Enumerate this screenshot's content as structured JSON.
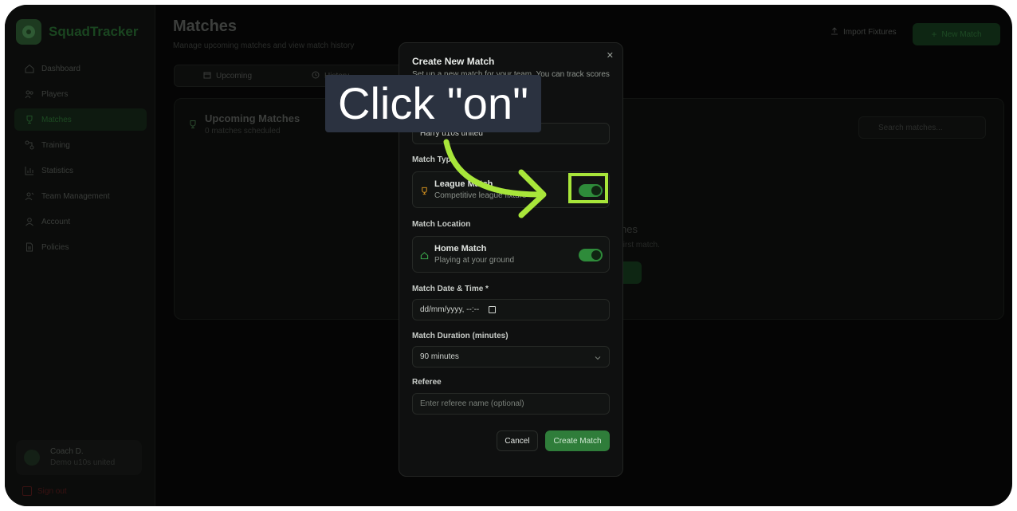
{
  "sidebar": {
    "brand": "SquadTracker",
    "items": [
      {
        "label": "Dashboard",
        "icon": "home-icon"
      },
      {
        "label": "Players",
        "icon": "users-icon"
      },
      {
        "label": "Matches",
        "icon": "trophy-icon"
      },
      {
        "label": "Training",
        "icon": "training-icon"
      },
      {
        "label": "Statistics",
        "icon": "chart-icon"
      },
      {
        "label": "Team Management",
        "icon": "team-icon"
      },
      {
        "label": "Account",
        "icon": "user-icon"
      },
      {
        "label": "Policies",
        "icon": "document-icon"
      }
    ],
    "active_item": "Matches",
    "user": {
      "name": "Coach D.",
      "team": "Demo u10s united"
    },
    "sign_out": "Sign out"
  },
  "header": {
    "title": "Matches",
    "subtitle": "Manage upcoming matches and view match history",
    "import_label": "Import Fixtures",
    "new_match_label": "New Match"
  },
  "tabs": [
    {
      "label": "Upcoming"
    },
    {
      "label": "History"
    }
  ],
  "upcoming_card": {
    "title": "Upcoming Matches",
    "subtitle": "0 matches scheduled",
    "search_placeholder": "Search matches...",
    "empty_title": "hes",
    "empty_subtitle": "first match."
  },
  "modal": {
    "title": "Create New Match",
    "description": "Set up a new match for your team. You can track scores",
    "team_value": "Harry u10s united",
    "match_type_label": "Match Type",
    "match_type": {
      "title": "League Match",
      "subtitle": "Competitive league fixture",
      "on": true
    },
    "location_label": "Match Location",
    "location": {
      "title": "Home Match",
      "subtitle": "Playing at your ground",
      "on": true
    },
    "datetime_label": "Match Date & Time *",
    "datetime_placeholder": "dd/mm/yyyy, --:--",
    "duration_label": "Match Duration (minutes)",
    "duration_value": "90 minutes",
    "referee_label": "Referee",
    "referee_placeholder": "Enter referee name (optional)",
    "cancel_label": "Cancel",
    "create_label": "Create Match"
  },
  "annotation": {
    "text": "Click \"on\"",
    "color": "#a8e63a"
  }
}
